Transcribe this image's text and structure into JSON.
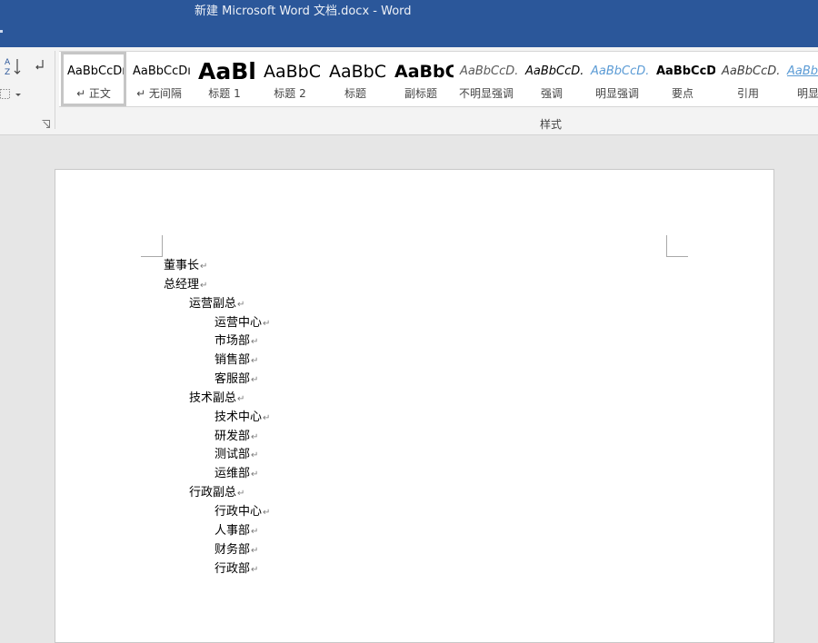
{
  "window": {
    "title": "新建 Microsoft Word 文档.docx - Word"
  },
  "ribbon": {
    "styles_group_label": "样式",
    "styles": [
      {
        "preview": "AaBbCcDı",
        "label": "↵ 正文",
        "selected": true
      },
      {
        "preview": "AaBbCcDı",
        "label": "↵ 无间隔"
      },
      {
        "preview": "AaBl",
        "label": "标题 1"
      },
      {
        "preview": "AaBbC",
        "label": "标题 2"
      },
      {
        "preview": "AaBbC",
        "label": "标题"
      },
      {
        "preview": "AaBbC",
        "label": "副标题"
      },
      {
        "preview": "AaBbCcD.",
        "label": "不明显强调"
      },
      {
        "preview": "AaBbCcD.",
        "label": "强调"
      },
      {
        "preview": "AaBbCcD.",
        "label": "明显强调"
      },
      {
        "preview": "AaBbCcD.",
        "label": "要点"
      },
      {
        "preview": "AaBbCcD.",
        "label": "引用"
      },
      {
        "preview": "AaBbC",
        "label": "明显引"
      }
    ]
  },
  "document": {
    "paragraph_mark": "↵",
    "lines": [
      {
        "text": "董事长",
        "level": 0
      },
      {
        "text": "总经理",
        "level": 0
      },
      {
        "text": "运营副总",
        "level": 1
      },
      {
        "text": "运营中心",
        "level": 2
      },
      {
        "text": "市场部",
        "level": 2
      },
      {
        "text": "销售部",
        "level": 2
      },
      {
        "text": "客服部",
        "level": 2
      },
      {
        "text": "技术副总",
        "level": 1
      },
      {
        "text": "技术中心",
        "level": 2
      },
      {
        "text": "研发部",
        "level": 2
      },
      {
        "text": "测试部",
        "level": 2
      },
      {
        "text": "运维部",
        "level": 2
      },
      {
        "text": "行政副总",
        "level": 1
      },
      {
        "text": "行政中心",
        "level": 2
      },
      {
        "text": "人事部",
        "level": 2
      },
      {
        "text": "财务部",
        "level": 2
      },
      {
        "text": "行政部",
        "level": 2
      }
    ]
  },
  "colors": {
    "titlebar": "#2b579a",
    "ribbon": "#f3f3f3",
    "workspace": "#e6e6e6",
    "subtle_emphasis": "#595959",
    "intense_emphasis": "#5b9bd5"
  }
}
